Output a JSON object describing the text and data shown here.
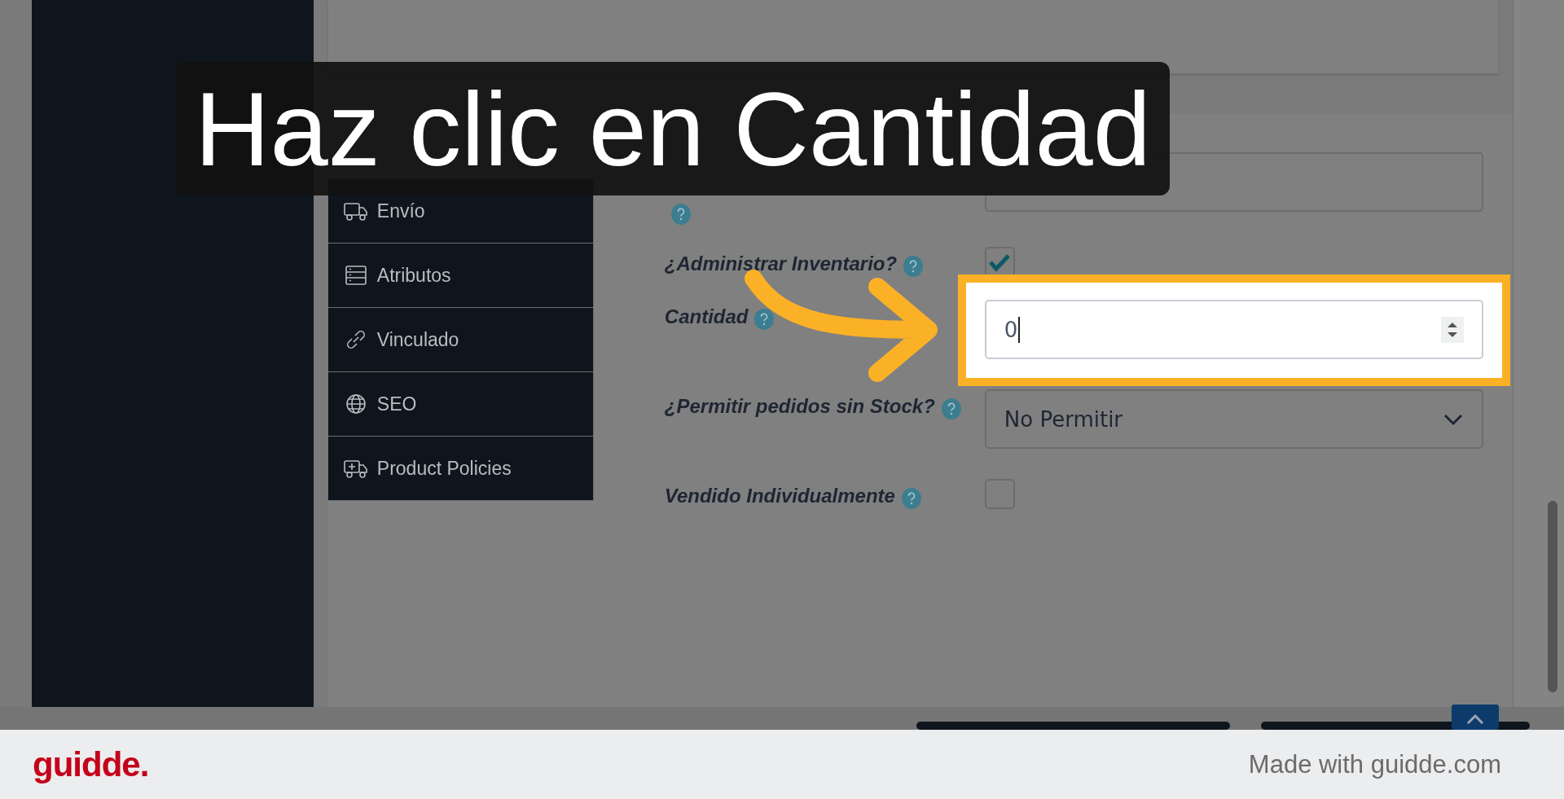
{
  "banner": {
    "text": "Haz clic en Cantidad"
  },
  "tabs": [
    {
      "label": "Envío",
      "selected": false
    },
    {
      "label": "Atributos",
      "selected": false
    },
    {
      "label": "Vinculado",
      "selected": false
    },
    {
      "label": "SEO",
      "selected": false
    },
    {
      "label": "Product Policies",
      "selected": false
    }
  ],
  "form": {
    "fields": [
      {
        "kind": "text",
        "highlighted": false
      },
      {
        "kind": "checkbox",
        "label": "¿Administrar Inventario?",
        "checked": true,
        "highlighted": false
      },
      {
        "kind": "number",
        "label": "Cantidad",
        "value": "0",
        "highlighted": true
      },
      {
        "kind": "select",
        "label": "¿Permitir pedidos sin Stock?",
        "value": "No Permitir",
        "highlighted": false
      },
      {
        "kind": "checkbox",
        "label": "Vendido Individualmente",
        "checked": false,
        "highlighted": false
      }
    ]
  },
  "footer": {
    "logo": "guidde.",
    "credit": "Made with guidde.com"
  }
}
